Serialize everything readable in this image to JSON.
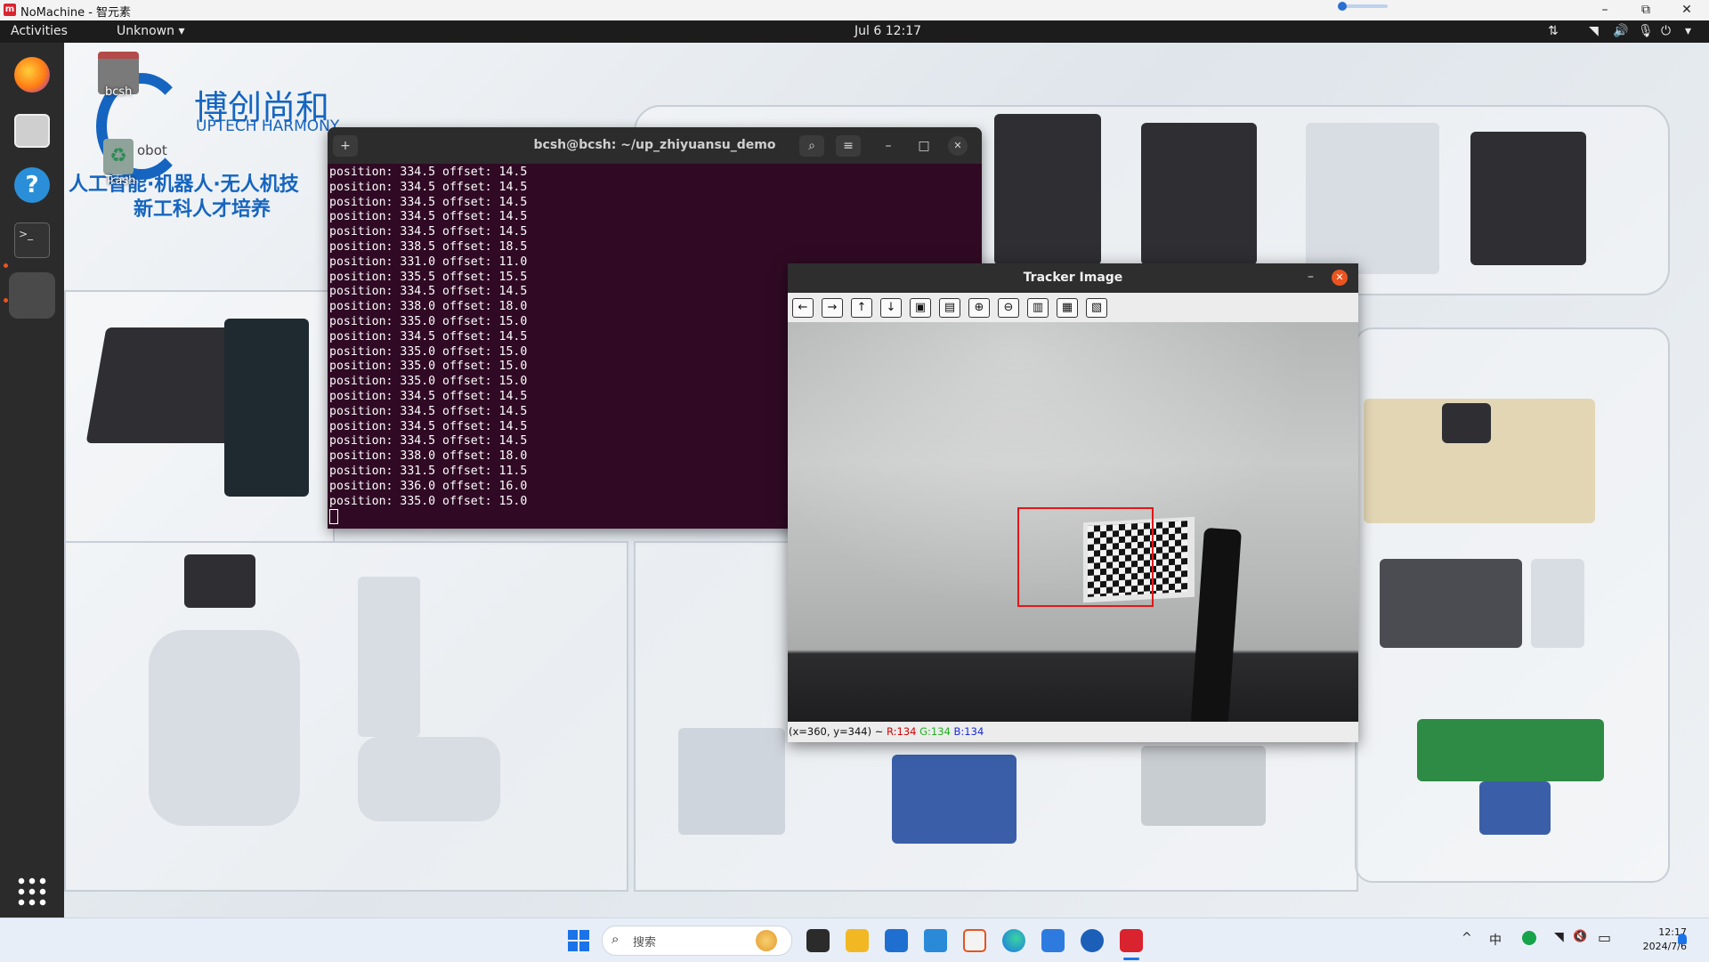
{
  "host": {
    "title": "NoMachine - 智元素",
    "logo_text": "m",
    "buttons": {
      "minimize": "–",
      "maximize": "⧉",
      "close": "✕"
    }
  },
  "gnome": {
    "activities": "Activities",
    "app_menu": "Unknown ▾",
    "clock": "Jul 6  12:17",
    "tray": {
      "network": "⇅",
      "wifi": "◥",
      "volume": "🔊",
      "mic": "🎙",
      "power": "⏻",
      "menu": "▾"
    }
  },
  "desktop": {
    "icons": [
      {
        "label": "bcsh"
      },
      {
        "label": "Trash"
      }
    ],
    "brand": {
      "cn_name": "博创尚和",
      "en_name": "UPTECH HARMONY",
      "slogan1": "人工智能·机器人·无人机技",
      "slogan2": "新工科人才培养",
      "side_text": "obot"
    }
  },
  "terminal": {
    "title": "bcsh@bcsh: ~/up_zhiyuansu_demo",
    "new_tab": "+",
    "search": "⌕",
    "menu": "≡",
    "minimize": "–",
    "maximize": "□",
    "close": "✕",
    "lines": [
      "position: 334.5 offset: 14.5",
      "position: 334.5 offset: 14.5",
      "position: 334.5 offset: 14.5",
      "position: 334.5 offset: 14.5",
      "position: 334.5 offset: 14.5",
      "position: 338.5 offset: 18.5",
      "position: 331.0 offset: 11.0",
      "position: 335.5 offset: 15.5",
      "position: 334.5 offset: 14.5",
      "position: 338.0 offset: 18.0",
      "position: 335.0 offset: 15.0",
      "position: 334.5 offset: 14.5",
      "position: 335.0 offset: 15.0",
      "position: 335.0 offset: 15.0",
      "position: 335.0 offset: 15.0",
      "position: 334.5 offset: 14.5",
      "position: 334.5 offset: 14.5",
      "position: 334.5 offset: 14.5",
      "position: 334.5 offset: 14.5",
      "position: 338.0 offset: 18.0",
      "position: 331.5 offset: 11.5",
      "position: 336.0 offset: 16.0",
      "position: 335.0 offset: 15.0"
    ]
  },
  "tracker": {
    "title": "Tracker Image",
    "minimize": "–",
    "close": "✕",
    "toolbar": [
      {
        "name": "pan-left-icon",
        "glyph": "←"
      },
      {
        "name": "pan-right-icon",
        "glyph": "→"
      },
      {
        "name": "pan-up-icon",
        "glyph": "↑"
      },
      {
        "name": "pan-down-icon",
        "glyph": "↓"
      },
      {
        "name": "zoom-to-window-icon",
        "glyph": "▣"
      },
      {
        "name": "zoom-original-icon",
        "glyph": "▤"
      },
      {
        "name": "zoom-in-icon",
        "glyph": "⊕"
      },
      {
        "name": "zoom-out-icon",
        "glyph": "⊖"
      },
      {
        "name": "save-image-icon",
        "glyph": "▥"
      },
      {
        "name": "copy-image-icon",
        "glyph": "▦"
      },
      {
        "name": "properties-icon",
        "glyph": "▧"
      }
    ],
    "status": {
      "coords": "(x=360, y=344) ~",
      "r": "R:134",
      "g": "G:134",
      "b": "B:134"
    },
    "colors": {
      "r": "#d40000",
      "g": "#20b020",
      "b": "#1a2ad6"
    }
  },
  "taskbar": {
    "search_placeholder": "搜索",
    "ime": "中",
    "time": "12:17",
    "date": "2024/7/6",
    "tray_wifi": "◥",
    "tray_sound": "🔇",
    "tray_battery": "▭",
    "chevron": "^"
  }
}
